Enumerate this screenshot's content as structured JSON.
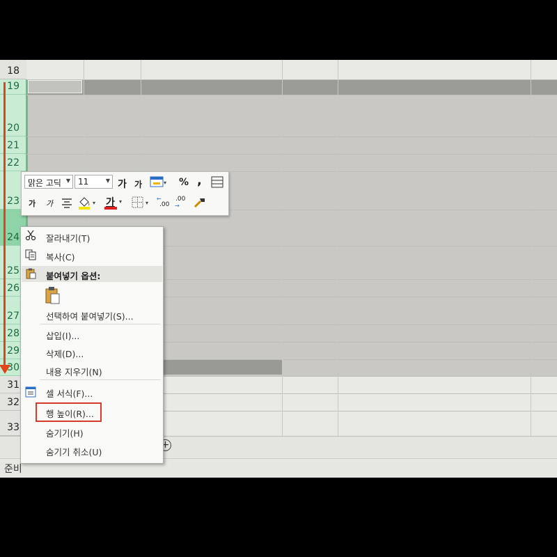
{
  "rows": [
    {
      "num": "18"
    },
    {
      "num": "19"
    },
    {
      "num": "20"
    },
    {
      "num": "21"
    },
    {
      "num": "22"
    },
    {
      "num": "23"
    },
    {
      "num": "24"
    },
    {
      "num": "25"
    },
    {
      "num": "26"
    },
    {
      "num": "27"
    },
    {
      "num": "28"
    },
    {
      "num": "29"
    },
    {
      "num": "30"
    },
    {
      "num": "31"
    },
    {
      "num": "32"
    },
    {
      "num": "33"
    }
  ],
  "mini_toolbar": {
    "font_name": "맑은 고딕",
    "font_size": "11",
    "grow_font": "가",
    "shrink_font": "가",
    "percent": "%",
    "comma": ",",
    "bold": "가",
    "italic": "가",
    "font_color_letter": "가",
    "inc_decimal": ".00",
    "dec_decimal": ".00"
  },
  "context_menu": {
    "cut": "잘라내기(T)",
    "copy": "복사(C)",
    "paste_options": "붙여넣기 옵션:",
    "paste_special": "선택하여 붙여넣기(S)...",
    "insert": "삽입(I)...",
    "delete": "삭제(D)...",
    "clear_contents": "내용 지우기(N)",
    "format_cells": "셀 서식(F)...",
    "row_height": "행 높이(R)...",
    "hide": "숨기기(H)",
    "unhide": "숨기기 취소(U)"
  },
  "status": {
    "text": "준비"
  },
  "colors": {
    "highlight": "#d83a2a",
    "arrow": "#e0451c",
    "selected_header": "#c8ecd4"
  }
}
